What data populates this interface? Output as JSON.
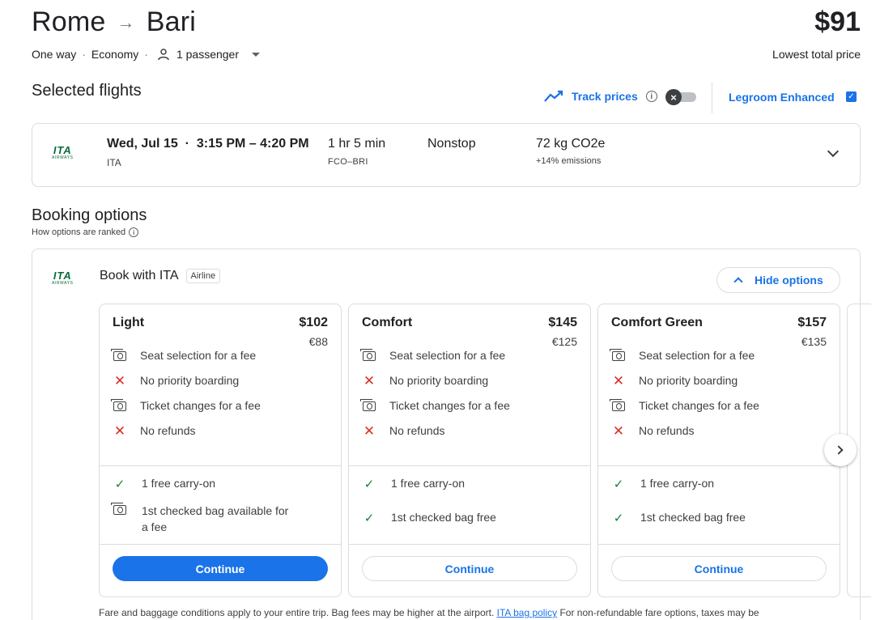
{
  "header": {
    "origin": "Rome",
    "destination": "Bari",
    "price": "$91",
    "price_caption": "Lowest total price",
    "trip_type": "One way",
    "cabin": "Economy",
    "passengers": "1 passenger"
  },
  "selected_flights": {
    "heading": "Selected flights",
    "track_prices_label": "Track prices",
    "legroom_label": "Legroom Enhanced",
    "legroom_checked": true,
    "flight": {
      "airline_logo_text": "ITA",
      "airline_logo_sub": "AIRWAYS",
      "date_time": "Wed, Jul 15  ·  3:15 PM – 4:20 PM",
      "airline": "ITA",
      "duration": "1 hr 5 min",
      "airports": "FCO–BRI",
      "stops": "Nonstop",
      "co2": "72 kg CO2e",
      "emissions": "+14% emissions"
    }
  },
  "booking": {
    "heading": "Booking options",
    "how_ranked": "How options are ranked",
    "book_with": "Book with ITA",
    "badge": "Airline",
    "hide_options": "Hide options",
    "fares": [
      {
        "name": "Light",
        "price": "$102",
        "eur": "€88",
        "features": [
          "Seat selection for a fee",
          "No priority boarding",
          "Ticket changes for a fee",
          "No refunds"
        ],
        "bags": [
          "1 free carry-on",
          "1st checked bag available for",
          "a fee"
        ],
        "button": "Continue"
      },
      {
        "name": "Comfort",
        "price": "$145",
        "eur": "€125",
        "features": [
          "Seat selection for a fee",
          "No priority boarding",
          "Ticket changes for a fee",
          "No refunds"
        ],
        "bags": [
          "1 free carry-on",
          "1st checked bag free"
        ],
        "button": "Continue"
      },
      {
        "name": "Comfort Green",
        "price": "$157",
        "eur": "€135",
        "features": [
          "Seat selection for a fee",
          "No priority boarding",
          "Ticket changes for a fee",
          "No refunds"
        ],
        "bags": [
          "1 free carry-on",
          "1st checked bag free"
        ],
        "button": "Continue"
      }
    ],
    "footnote_prefix": "Fare and baggage conditions apply to your entire trip. Bag fees may be higher at the airport.",
    "footnote_link": "ITA bag policy",
    "footnote_suffix": "For non-refundable fare options, taxes may be"
  },
  "colors": {
    "accent": "#1a73e8",
    "danger": "#d93025",
    "success": "#188038",
    "ita_green": "#0a6b3d"
  }
}
